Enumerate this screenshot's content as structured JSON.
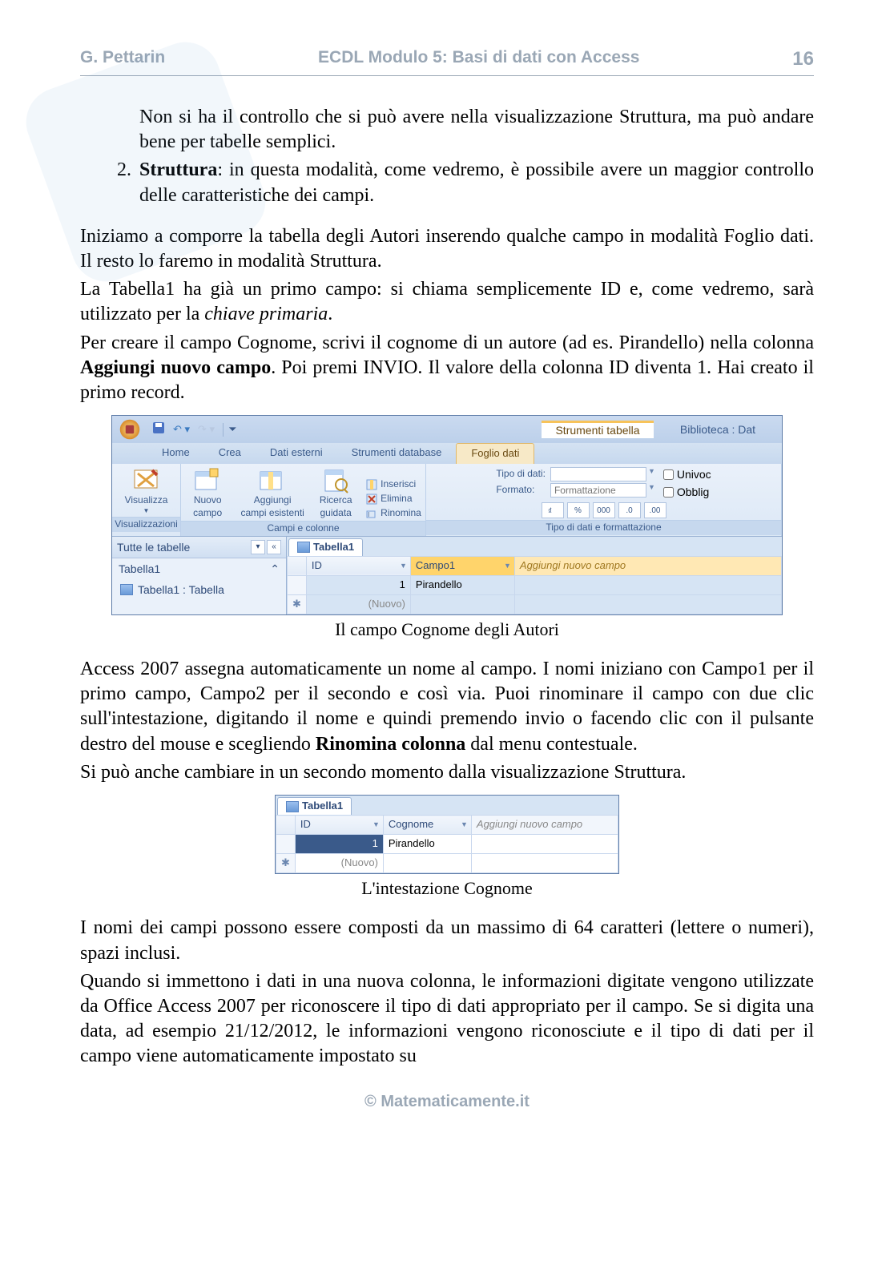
{
  "header": {
    "author": "G. Pettarin",
    "title": "ECDL Modulo 5: Basi di dati con Access",
    "page": "16"
  },
  "p_ind": "Non si ha il controllo che si può avere nella visualizzazione Struttura, ma può andare bene per tabelle semplici.",
  "li2_num": "2.",
  "li2_lead": "Struttura",
  "li2_rest": ": in questa modalità, come vedremo, è possibile avere un maggior controllo delle caratteristiche dei campi.",
  "p1": "Iniziamo a comporre la tabella degli Autori inserendo qualche campo in modalità Foglio dati. Il resto lo faremo in modalità Struttura.",
  "p2a": "La Tabella1 ha già un primo campo: si chiama semplicemente ID e, come vedremo, sarà utilizzato per la ",
  "p2_em": "chiave primaria",
  "p2b": ".",
  "p3a": "Per creare il campo Cognome, scrivi il cognome di un autore (ad es. Pirandello) nella colonna ",
  "p3_b": "Aggiungi nuovo campo",
  "p3b": ". Poi premi INVIO. Il valore della colonna ID diventa 1. Hai creato il primo record.",
  "shot1": {
    "ctx_tab": "Strumenti tabella",
    "wintitle": "Biblioteca : Dat",
    "tabs": [
      "Home",
      "Crea",
      "Dati esterni",
      "Strumenti database",
      "Foglio dati"
    ],
    "grp_vis": {
      "btn": "Visualizza",
      "label": "Visualizzazioni"
    },
    "grp_campi": {
      "b1a": "Nuovo",
      "b1b": "campo",
      "b2a": "Aggiungi",
      "b2b": "campi esistenti",
      "b3a": "Ricerca",
      "b3b": "guidata",
      "s1": "Inserisci",
      "s2": "Elimina",
      "s3": "Rinomina",
      "label": "Campi e colonne"
    },
    "grp_fmt": {
      "l1": "Tipo di dati:",
      "l2": "Formato:",
      "fmt_ph": "Formattazione",
      "c1": "Univoc",
      "c2": "Obblig",
      "label": "Tipo di dati e formattazione",
      "nums": [
        "%",
        "000",
        ".0",
        ".00"
      ]
    },
    "nav": {
      "hdr": "Tutte le tabelle",
      "grp": "Tabella1",
      "item": "Tabella1 : Tabella"
    },
    "tab": "Tabella1",
    "cols": {
      "id": "ID",
      "campo1": "Campo1",
      "add": "Aggiungi nuovo campo"
    },
    "row1": {
      "id": "1",
      "campo1": "Pirandello"
    },
    "row2": "(Nuovo)"
  },
  "cap1": "Il campo Cognome degli Autori",
  "p4a": "Access 2007 assegna automaticamente un nome al campo. I nomi iniziano con Campo1 per il primo campo, Campo2 per il secondo e così via. Puoi rinominare il campo con due clic sull'intestazione, digitando il nome e quindi premendo invio o facendo clic con il pulsante destro del mouse e scegliendo ",
  "p4_b": "Rinomina colonna",
  "p4b": " dal menu contestuale.",
  "p5": "Si può anche cambiare in un secondo momento dalla visualizzazione Struttura.",
  "shot2": {
    "tab": "Tabella1",
    "cols": {
      "id": "ID",
      "cog": "Cognome",
      "add": "Aggiungi nuovo campo"
    },
    "row1": {
      "id": "1",
      "cog": "Pirandello"
    },
    "row2": "(Nuovo)"
  },
  "cap2": "L'intestazione Cognome",
  "p6": "I nomi dei campi possono essere composti da un massimo di 64 caratteri (lettere o numeri), spazi inclusi.",
  "p7": "Quando si immettono i dati in una nuova colonna, le informazioni digitate vengono utilizzate da Office Access 2007 per riconoscere il tipo di dati appropriato per il campo. Se si digita una data, ad esempio 21/12/2012, le informazioni vengono riconosciute e il tipo di dati per il campo viene automaticamente impostato su",
  "footer": "© Matematicamente.it"
}
